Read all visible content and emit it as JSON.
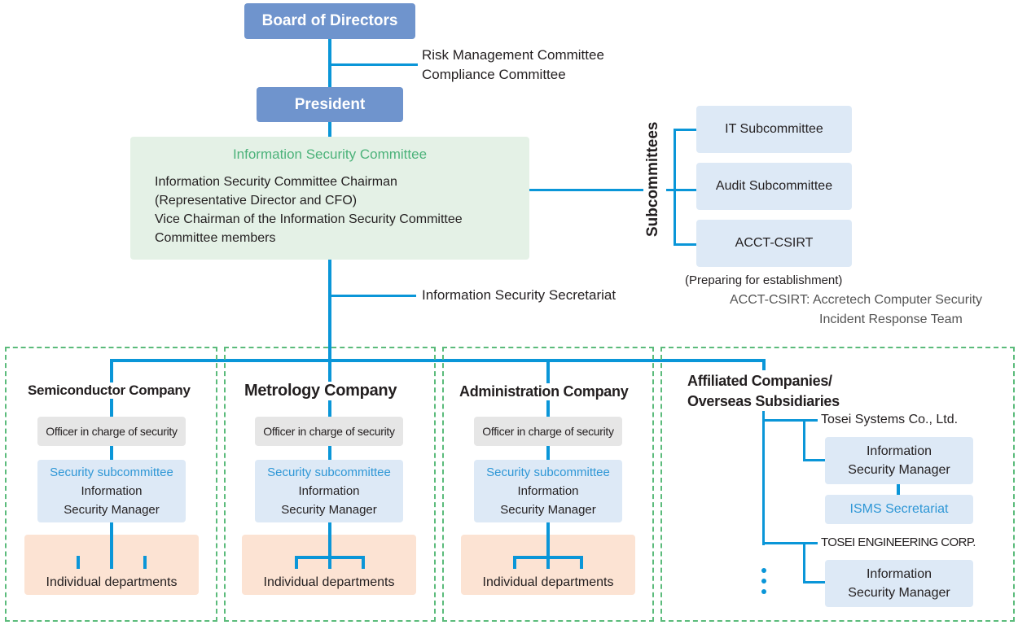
{
  "top": {
    "board": "Board of Directors",
    "president": "President",
    "side_committees": [
      "Risk Management Committee",
      "Compliance Committee"
    ]
  },
  "isc": {
    "title": "Information Security Committee",
    "lines": [
      "Information Security Committee Chairman",
      "(Representative Director and CFO)",
      "Vice Chairman of the Information Security Committee",
      "Committee members"
    ]
  },
  "subcommittees": {
    "label": "Subcommittees",
    "items": [
      "IT Subcommittee",
      "Audit Subcommittee",
      "ACCT-CSIRT"
    ],
    "note": "(Preparing for establishment)",
    "footnote_lines": [
      "ACCT-CSIRT: Accretech Computer Security",
      "Incident Response Team"
    ]
  },
  "secretariat": "Information Security Secretariat",
  "companies": [
    {
      "name": "Semiconductor Company",
      "officer": "Officer in charge of security",
      "subcommittee": "Security subcommittee",
      "manager_lines": [
        "Information",
        "Security Manager"
      ],
      "departments": "Individual departments"
    },
    {
      "name": "Metrology Company",
      "officer": "Officer in charge of security",
      "subcommittee": "Security subcommittee",
      "manager_lines": [
        "Information",
        "Security Manager"
      ],
      "departments": "Individual departments"
    },
    {
      "name": "Administration Company",
      "officer": "Officer in charge of security",
      "subcommittee": "Security subcommittee",
      "manager_lines": [
        "Information",
        "Security Manager"
      ],
      "departments": "Individual departments"
    }
  ],
  "affiliates": {
    "title_lines": [
      "Affiliated Companies/",
      "Overseas Subsidiaries"
    ],
    "entities": [
      {
        "name": "Tosei Systems Co., Ltd.",
        "manager_lines": [
          "Information",
          "Security Manager"
        ],
        "secretariat": "ISMS Secretariat"
      },
      {
        "name": "TOSEI ENGINEERING CORP.",
        "manager_lines": [
          "Information",
          "Security Manager"
        ]
      }
    ]
  },
  "colors": {
    "connector": "#0a96d8",
    "top_box": "#6f94cd",
    "committee_bg": "#e4f1e6",
    "committee_title": "#4cb27a",
    "accent_text": "#2f97d6",
    "dashed_border": "#5bbb7b",
    "dept_bg": "#fce3d3"
  }
}
